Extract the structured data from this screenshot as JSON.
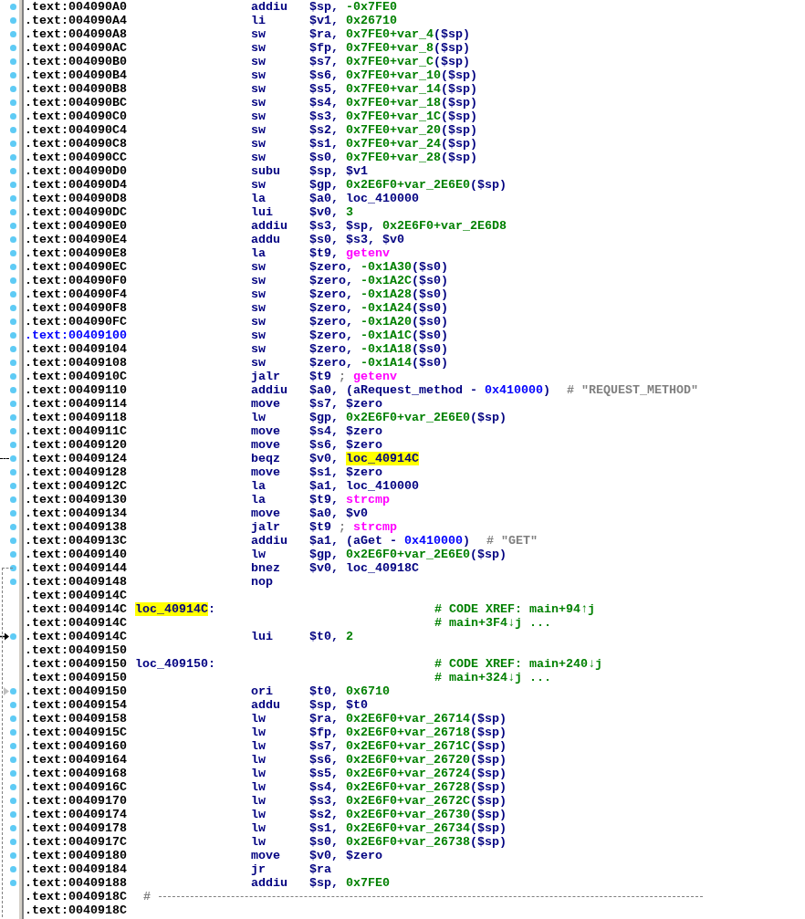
{
  "listing": {
    "rows": [
      {
        "address": ".text:004090A0",
        "dot": true,
        "selected": false,
        "mnemonic": "addiu",
        "operands": [
          {
            "kind": "reg",
            "text": "$sp, "
          },
          {
            "kind": "num",
            "text": "-0x7FE0"
          }
        ]
      },
      {
        "address": ".text:004090A4",
        "dot": true,
        "selected": false,
        "mnemonic": "li",
        "operands": [
          {
            "kind": "reg",
            "text": "$v1, "
          },
          {
            "kind": "num",
            "text": "0x26710"
          }
        ]
      },
      {
        "address": ".text:004090A8",
        "dot": true,
        "selected": false,
        "mnemonic": "sw",
        "operands": [
          {
            "kind": "reg",
            "text": "$ra, "
          },
          {
            "kind": "num",
            "text": "0x7FE0+var_4"
          },
          {
            "kind": "reg",
            "text": "($sp)"
          }
        ]
      },
      {
        "address": ".text:004090AC",
        "dot": true,
        "selected": false,
        "mnemonic": "sw",
        "operands": [
          {
            "kind": "reg",
            "text": "$fp, "
          },
          {
            "kind": "num",
            "text": "0x7FE0+var_8"
          },
          {
            "kind": "reg",
            "text": "($sp)"
          }
        ]
      },
      {
        "address": ".text:004090B0",
        "dot": true,
        "selected": false,
        "mnemonic": "sw",
        "operands": [
          {
            "kind": "reg",
            "text": "$s7, "
          },
          {
            "kind": "num",
            "text": "0x7FE0+var_C"
          },
          {
            "kind": "reg",
            "text": "($sp)"
          }
        ]
      },
      {
        "address": ".text:004090B4",
        "dot": true,
        "selected": false,
        "mnemonic": "sw",
        "operands": [
          {
            "kind": "reg",
            "text": "$s6, "
          },
          {
            "kind": "num",
            "text": "0x7FE0+var_10"
          },
          {
            "kind": "reg",
            "text": "($sp)"
          }
        ]
      },
      {
        "address": ".text:004090B8",
        "dot": true,
        "selected": false,
        "mnemonic": "sw",
        "operands": [
          {
            "kind": "reg",
            "text": "$s5, "
          },
          {
            "kind": "num",
            "text": "0x7FE0+var_14"
          },
          {
            "kind": "reg",
            "text": "($sp)"
          }
        ]
      },
      {
        "address": ".text:004090BC",
        "dot": true,
        "selected": false,
        "mnemonic": "sw",
        "operands": [
          {
            "kind": "reg",
            "text": "$s4, "
          },
          {
            "kind": "num",
            "text": "0x7FE0+var_18"
          },
          {
            "kind": "reg",
            "text": "($sp)"
          }
        ]
      },
      {
        "address": ".text:004090C0",
        "dot": true,
        "selected": false,
        "mnemonic": "sw",
        "operands": [
          {
            "kind": "reg",
            "text": "$s3, "
          },
          {
            "kind": "num",
            "text": "0x7FE0+var_1C"
          },
          {
            "kind": "reg",
            "text": "($sp)"
          }
        ]
      },
      {
        "address": ".text:004090C4",
        "dot": true,
        "selected": false,
        "mnemonic": "sw",
        "operands": [
          {
            "kind": "reg",
            "text": "$s2, "
          },
          {
            "kind": "num",
            "text": "0x7FE0+var_20"
          },
          {
            "kind": "reg",
            "text": "($sp)"
          }
        ]
      },
      {
        "address": ".text:004090C8",
        "dot": true,
        "selected": false,
        "mnemonic": "sw",
        "operands": [
          {
            "kind": "reg",
            "text": "$s1, "
          },
          {
            "kind": "num",
            "text": "0x7FE0+var_24"
          },
          {
            "kind": "reg",
            "text": "($sp)"
          }
        ]
      },
      {
        "address": ".text:004090CC",
        "dot": true,
        "selected": false,
        "mnemonic": "sw",
        "operands": [
          {
            "kind": "reg",
            "text": "$s0, "
          },
          {
            "kind": "num",
            "text": "0x7FE0+var_28"
          },
          {
            "kind": "reg",
            "text": "($sp)"
          }
        ]
      },
      {
        "address": ".text:004090D0",
        "dot": true,
        "selected": false,
        "mnemonic": "subu",
        "operands": [
          {
            "kind": "reg",
            "text": "$sp, $v1"
          }
        ]
      },
      {
        "address": ".text:004090D4",
        "dot": true,
        "selected": false,
        "mnemonic": "sw",
        "operands": [
          {
            "kind": "reg",
            "text": "$gp, "
          },
          {
            "kind": "num",
            "text": "0x2E6F0+var_2E6E0"
          },
          {
            "kind": "reg",
            "text": "($sp)"
          }
        ]
      },
      {
        "address": ".text:004090D8",
        "dot": true,
        "selected": false,
        "mnemonic": "la",
        "operands": [
          {
            "kind": "reg",
            "text": "$a0, loc_410000"
          }
        ]
      },
      {
        "address": ".text:004090DC",
        "dot": true,
        "selected": false,
        "mnemonic": "lui",
        "operands": [
          {
            "kind": "reg",
            "text": "$v0, "
          },
          {
            "kind": "num",
            "text": "3"
          }
        ]
      },
      {
        "address": ".text:004090E0",
        "dot": true,
        "selected": false,
        "mnemonic": "addiu",
        "operands": [
          {
            "kind": "reg",
            "text": "$s3, $sp, "
          },
          {
            "kind": "num",
            "text": "0x2E6F0+var_2E6D8"
          }
        ]
      },
      {
        "address": ".text:004090E4",
        "dot": true,
        "selected": false,
        "mnemonic": "addu",
        "operands": [
          {
            "kind": "reg",
            "text": "$s0, $s3, $v0"
          }
        ]
      },
      {
        "address": ".text:004090E8",
        "dot": true,
        "selected": false,
        "mnemonic": "la",
        "operands": [
          {
            "kind": "reg",
            "text": "$t9, "
          },
          {
            "kind": "func",
            "text": "getenv"
          }
        ]
      },
      {
        "address": ".text:004090EC",
        "dot": true,
        "selected": false,
        "mnemonic": "sw",
        "operands": [
          {
            "kind": "reg",
            "text": "$zero, "
          },
          {
            "kind": "num",
            "text": "-0x1A30"
          },
          {
            "kind": "reg",
            "text": "($s0)"
          }
        ]
      },
      {
        "address": ".text:004090F0",
        "dot": true,
        "selected": false,
        "mnemonic": "sw",
        "operands": [
          {
            "kind": "reg",
            "text": "$zero, "
          },
          {
            "kind": "num",
            "text": "-0x1A2C"
          },
          {
            "kind": "reg",
            "text": "($s0)"
          }
        ]
      },
      {
        "address": ".text:004090F4",
        "dot": true,
        "selected": false,
        "mnemonic": "sw",
        "operands": [
          {
            "kind": "reg",
            "text": "$zero, "
          },
          {
            "kind": "num",
            "text": "-0x1A28"
          },
          {
            "kind": "reg",
            "text": "($s0)"
          }
        ]
      },
      {
        "address": ".text:004090F8",
        "dot": true,
        "selected": false,
        "mnemonic": "sw",
        "operands": [
          {
            "kind": "reg",
            "text": "$zero, "
          },
          {
            "kind": "num",
            "text": "-0x1A24"
          },
          {
            "kind": "reg",
            "text": "($s0)"
          }
        ]
      },
      {
        "address": ".text:004090FC",
        "dot": true,
        "selected": false,
        "mnemonic": "sw",
        "operands": [
          {
            "kind": "reg",
            "text": "$zero, "
          },
          {
            "kind": "num",
            "text": "-0x1A20"
          },
          {
            "kind": "reg",
            "text": "($s0)"
          }
        ]
      },
      {
        "address": ".text:00409100",
        "dot": true,
        "selected": true,
        "mnemonic": "sw",
        "operands": [
          {
            "kind": "reg",
            "text": "$zero, "
          },
          {
            "kind": "num",
            "text": "-0x1A1C"
          },
          {
            "kind": "reg",
            "text": "($s0)"
          }
        ]
      },
      {
        "address": ".text:00409104",
        "dot": true,
        "selected": false,
        "mnemonic": "sw",
        "operands": [
          {
            "kind": "reg",
            "text": "$zero, "
          },
          {
            "kind": "num",
            "text": "-0x1A18"
          },
          {
            "kind": "reg",
            "text": "($s0)"
          }
        ]
      },
      {
        "address": ".text:00409108",
        "dot": true,
        "selected": false,
        "mnemonic": "sw",
        "operands": [
          {
            "kind": "reg",
            "text": "$zero, "
          },
          {
            "kind": "num",
            "text": "-0x1A14"
          },
          {
            "kind": "reg",
            "text": "($s0)"
          }
        ]
      },
      {
        "address": ".text:0040910C",
        "dot": true,
        "selected": false,
        "mnemonic": "jalr",
        "operands": [
          {
            "kind": "reg",
            "text": "$t9 "
          },
          {
            "kind": "sep",
            "text": "; "
          },
          {
            "kind": "func",
            "text": "getenv"
          }
        ]
      },
      {
        "address": ".text:00409110",
        "dot": true,
        "selected": false,
        "mnemonic": "addiu",
        "operands": [
          {
            "kind": "reg",
            "text": "$a0, (aRequest_method - "
          },
          {
            "kind": "imm",
            "text": "0x410000"
          },
          {
            "kind": "reg",
            "text": ")"
          }
        ],
        "comment": {
          "kind": "string",
          "text": "# \"REQUEST_METHOD\""
        }
      },
      {
        "address": ".text:00409114",
        "dot": true,
        "selected": false,
        "mnemonic": "move",
        "operands": [
          {
            "kind": "reg",
            "text": "$s7, $zero"
          }
        ]
      },
      {
        "address": ".text:00409118",
        "dot": true,
        "selected": false,
        "mnemonic": "lw",
        "operands": [
          {
            "kind": "reg",
            "text": "$gp, "
          },
          {
            "kind": "num",
            "text": "0x2E6F0+var_2E6E0"
          },
          {
            "kind": "reg",
            "text": "($sp)"
          }
        ]
      },
      {
        "address": ".text:0040911C",
        "dot": true,
        "selected": false,
        "mnemonic": "move",
        "operands": [
          {
            "kind": "reg",
            "text": "$s4, $zero"
          }
        ]
      },
      {
        "address": ".text:00409120",
        "dot": true,
        "selected": false,
        "mnemonic": "move",
        "operands": [
          {
            "kind": "reg",
            "text": "$s6, $zero"
          }
        ]
      },
      {
        "address": ".text:00409124",
        "dot": true,
        "selected": false,
        "arrow": {
          "kind": "branch_out"
        },
        "mnemonic": "beqz",
        "operands": [
          {
            "kind": "reg",
            "text": "$v0, "
          },
          {
            "kind": "highlight",
            "text": "loc_40914C"
          }
        ]
      },
      {
        "address": ".text:00409128",
        "dot": true,
        "selected": false,
        "mnemonic": "move",
        "operands": [
          {
            "kind": "reg",
            "text": "$s1, $zero"
          }
        ]
      },
      {
        "address": ".text:0040912C",
        "dot": true,
        "selected": false,
        "mnemonic": "la",
        "operands": [
          {
            "kind": "reg",
            "text": "$a1, loc_410000"
          }
        ]
      },
      {
        "address": ".text:00409130",
        "dot": true,
        "selected": false,
        "mnemonic": "la",
        "operands": [
          {
            "kind": "reg",
            "text": "$t9, "
          },
          {
            "kind": "func",
            "text": "strcmp"
          }
        ]
      },
      {
        "address": ".text:00409134",
        "dot": true,
        "selected": false,
        "mnemonic": "move",
        "operands": [
          {
            "kind": "reg",
            "text": "$a0, $v0"
          }
        ]
      },
      {
        "address": ".text:00409138",
        "dot": true,
        "selected": false,
        "mnemonic": "jalr",
        "operands": [
          {
            "kind": "reg",
            "text": "$t9 "
          },
          {
            "kind": "sep",
            "text": "; "
          },
          {
            "kind": "func",
            "text": "strcmp"
          }
        ]
      },
      {
        "address": ".text:0040913C",
        "dot": true,
        "selected": false,
        "mnemonic": "addiu",
        "operands": [
          {
            "kind": "reg",
            "text": "$a1, (aGet - "
          },
          {
            "kind": "imm",
            "text": "0x410000"
          },
          {
            "kind": "reg",
            "text": ")"
          }
        ],
        "comment": {
          "kind": "string",
          "text": "# \"GET\""
        }
      },
      {
        "address": ".text:00409140",
        "dot": true,
        "selected": false,
        "mnemonic": "lw",
        "operands": [
          {
            "kind": "reg",
            "text": "$gp, "
          },
          {
            "kind": "num",
            "text": "0x2E6F0+var_2E6E0"
          },
          {
            "kind": "reg",
            "text": "($sp)"
          }
        ]
      },
      {
        "address": ".text:00409144",
        "dot": true,
        "selected": false,
        "arrow": {
          "kind": "branch_down"
        },
        "mnemonic": "bnez",
        "operands": [
          {
            "kind": "reg",
            "text": "$v0, loc_40918C"
          }
        ]
      },
      {
        "address": ".text:00409148",
        "dot": true,
        "selected": false,
        "mnemonic": "nop"
      },
      {
        "address": ".text:0040914C",
        "dot": false,
        "selected": false
      },
      {
        "address": ".text:0040914C",
        "dot": false,
        "selected": false,
        "label": {
          "text": "loc_40914C",
          "suffix": ":",
          "highlighted": true
        },
        "comment": {
          "kind": "xref",
          "text": "# CODE XREF: main+94↑j"
        }
      },
      {
        "address": ".text:0040914C",
        "dot": false,
        "selected": false,
        "comment": {
          "kind": "xref",
          "text": "# main+3F4↓j ..."
        }
      },
      {
        "address": ".text:0040914C",
        "dot": true,
        "selected": false,
        "arrow": {
          "kind": "arrow_in"
        },
        "mnemonic": "lui",
        "operands": [
          {
            "kind": "reg",
            "text": "$t0, "
          },
          {
            "kind": "num",
            "text": "2"
          }
        ]
      },
      {
        "address": ".text:00409150",
        "dot": false,
        "selected": false
      },
      {
        "address": ".text:00409150",
        "dot": false,
        "selected": false,
        "label": {
          "text": "loc_409150",
          "suffix": ":",
          "highlighted": false
        },
        "comment": {
          "kind": "xref",
          "text": "# CODE XREF: main+240↓j"
        }
      },
      {
        "address": ".text:00409150",
        "dot": false,
        "selected": false,
        "comment": {
          "kind": "xref",
          "text": "# main+324↓j ..."
        }
      },
      {
        "address": ".text:00409150",
        "dot": true,
        "selected": false,
        "arrow": {
          "kind": "triangle"
        },
        "mnemonic": "ori",
        "operands": [
          {
            "kind": "reg",
            "text": "$t0, "
          },
          {
            "kind": "num",
            "text": "0x6710"
          }
        ]
      },
      {
        "address": ".text:00409154",
        "dot": true,
        "selected": false,
        "mnemonic": "addu",
        "operands": [
          {
            "kind": "reg",
            "text": "$sp, $t0"
          }
        ]
      },
      {
        "address": ".text:00409158",
        "dot": true,
        "selected": false,
        "mnemonic": "lw",
        "operands": [
          {
            "kind": "reg",
            "text": "$ra, "
          },
          {
            "kind": "num",
            "text": "0x2E6F0+var_26714"
          },
          {
            "kind": "reg",
            "text": "($sp)"
          }
        ]
      },
      {
        "address": ".text:0040915C",
        "dot": true,
        "selected": false,
        "mnemonic": "lw",
        "operands": [
          {
            "kind": "reg",
            "text": "$fp, "
          },
          {
            "kind": "num",
            "text": "0x2E6F0+var_26718"
          },
          {
            "kind": "reg",
            "text": "($sp)"
          }
        ]
      },
      {
        "address": ".text:00409160",
        "dot": true,
        "selected": false,
        "mnemonic": "lw",
        "operands": [
          {
            "kind": "reg",
            "text": "$s7, "
          },
          {
            "kind": "num",
            "text": "0x2E6F0+var_2671C"
          },
          {
            "kind": "reg",
            "text": "($sp)"
          }
        ]
      },
      {
        "address": ".text:00409164",
        "dot": true,
        "selected": false,
        "mnemonic": "lw",
        "operands": [
          {
            "kind": "reg",
            "text": "$s6, "
          },
          {
            "kind": "num",
            "text": "0x2E6F0+var_26720"
          },
          {
            "kind": "reg",
            "text": "($sp)"
          }
        ]
      },
      {
        "address": ".text:00409168",
        "dot": true,
        "selected": false,
        "mnemonic": "lw",
        "operands": [
          {
            "kind": "reg",
            "text": "$s5, "
          },
          {
            "kind": "num",
            "text": "0x2E6F0+var_26724"
          },
          {
            "kind": "reg",
            "text": "($sp)"
          }
        ]
      },
      {
        "address": ".text:0040916C",
        "dot": true,
        "selected": false,
        "mnemonic": "lw",
        "operands": [
          {
            "kind": "reg",
            "text": "$s4, "
          },
          {
            "kind": "num",
            "text": "0x2E6F0+var_26728"
          },
          {
            "kind": "reg",
            "text": "($sp)"
          }
        ]
      },
      {
        "address": ".text:00409170",
        "dot": true,
        "selected": false,
        "mnemonic": "lw",
        "operands": [
          {
            "kind": "reg",
            "text": "$s3, "
          },
          {
            "kind": "num",
            "text": "0x2E6F0+var_2672C"
          },
          {
            "kind": "reg",
            "text": "($sp)"
          }
        ]
      },
      {
        "address": ".text:00409174",
        "dot": true,
        "selected": false,
        "mnemonic": "lw",
        "operands": [
          {
            "kind": "reg",
            "text": "$s2, "
          },
          {
            "kind": "num",
            "text": "0x2E6F0+var_26730"
          },
          {
            "kind": "reg",
            "text": "($sp)"
          }
        ]
      },
      {
        "address": ".text:00409178",
        "dot": true,
        "selected": false,
        "mnemonic": "lw",
        "operands": [
          {
            "kind": "reg",
            "text": "$s1, "
          },
          {
            "kind": "num",
            "text": "0x2E6F0+var_26734"
          },
          {
            "kind": "reg",
            "text": "($sp)"
          }
        ]
      },
      {
        "address": ".text:0040917C",
        "dot": true,
        "selected": false,
        "mnemonic": "lw",
        "operands": [
          {
            "kind": "reg",
            "text": "$s0, "
          },
          {
            "kind": "num",
            "text": "0x2E6F0+var_26738"
          },
          {
            "kind": "reg",
            "text": "($sp)"
          }
        ]
      },
      {
        "address": ".text:00409180",
        "dot": true,
        "selected": false,
        "mnemonic": "move",
        "operands": [
          {
            "kind": "reg",
            "text": "$v0, $zero"
          }
        ]
      },
      {
        "address": ".text:00409184",
        "dot": true,
        "selected": false,
        "mnemonic": "jr",
        "operands": [
          {
            "kind": "reg",
            "text": "$ra"
          }
        ]
      },
      {
        "address": ".text:00409188",
        "dot": true,
        "selected": false,
        "mnemonic": "addiu",
        "operands": [
          {
            "kind": "reg",
            "text": "$sp, "
          },
          {
            "kind": "num",
            "text": "0x7FE0"
          }
        ]
      },
      {
        "address": ".text:0040918C",
        "dot": false,
        "selected": false,
        "comment": {
          "kind": "separator",
          "text": "#"
        }
      },
      {
        "address": ".text:0040918C",
        "dot": false,
        "selected": false
      }
    ]
  }
}
